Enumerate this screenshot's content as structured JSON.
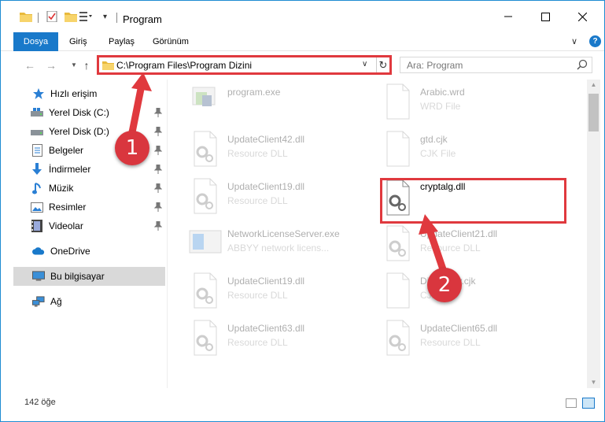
{
  "window": {
    "title": "Program"
  },
  "ribbon": {
    "tabs": [
      "Dosya",
      "Giriş",
      "Paylaş",
      "Görünüm"
    ]
  },
  "nav": {
    "address": "C:\\Program Files\\Program Dizini",
    "search_placeholder": "Ara: Program"
  },
  "sidebar": {
    "items": [
      {
        "label": "Hızlı erişim",
        "icon": "star-icon"
      },
      {
        "label": "Yerel Disk (C:)",
        "icon": "drive-icon"
      },
      {
        "label": "Yerel Disk (D:)",
        "icon": "drive-icon"
      },
      {
        "label": "Belgeler",
        "icon": "documents-icon"
      },
      {
        "label": "İndirmeler",
        "icon": "download-icon"
      },
      {
        "label": "Müzik",
        "icon": "music-icon"
      },
      {
        "label": "Resimler",
        "icon": "pictures-icon"
      },
      {
        "label": "Videolar",
        "icon": "video-icon"
      },
      {
        "label": "OneDrive",
        "icon": "cloud-icon"
      },
      {
        "label": "Bu bilgisayar",
        "icon": "computer-icon"
      },
      {
        "label": "Ağ",
        "icon": "network-icon"
      }
    ]
  },
  "files": [
    {
      "name": "program.exe",
      "type": ""
    },
    {
      "name": "Arabic.wrd",
      "type": "WRD File"
    },
    {
      "name": "UpdateClient42.dll",
      "type": "Resource DLL"
    },
    {
      "name": "gtd.cjk",
      "type": "CJK File"
    },
    {
      "name": "UpdateClient19.dll",
      "type": "Resource DLL"
    },
    {
      "name": "cryptalg.dll",
      "type": ""
    },
    {
      "name": "NetworkLicenseServer.exe",
      "type": "ABBYY network licens..."
    },
    {
      "name": "UpdateClient21.dll",
      "type": "Resource DLL"
    },
    {
      "name": "UpdateClient19.dll",
      "type": "Resource DLL"
    },
    {
      "name": "Dictionary.cjk",
      "type": "CJK File"
    },
    {
      "name": "UpdateClient63.dll",
      "type": "Resource DLL"
    },
    {
      "name": "UpdateClient65.dll",
      "type": "Resource DLL"
    }
  ],
  "status": {
    "item_count": "142 öğe"
  },
  "annotations": {
    "callout_1": "1",
    "callout_2": "2"
  },
  "colors": {
    "accent": "#1979ca",
    "annotation_red": "#e0393e"
  }
}
